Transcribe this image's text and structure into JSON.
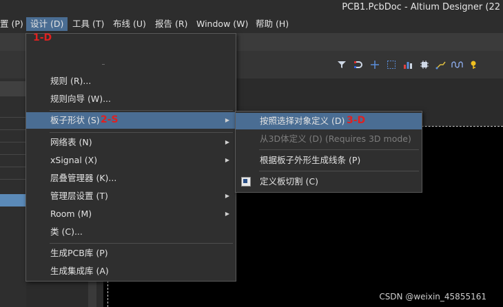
{
  "window": {
    "title": "PCB1.PcbDoc - Altium Designer (22"
  },
  "menubar": {
    "items": [
      "置 (P)",
      "设计 (D)",
      "工具 (T)",
      "布线 (U)",
      "报告 (R)",
      "Window (W)",
      "帮助 (H)"
    ]
  },
  "design_menu": {
    "items": [
      {
        "label": "规则 (R)..."
      },
      {
        "label": "规则向导 (W)..."
      },
      {
        "label": "板子形状 (S)"
      },
      {
        "label": "网络表 (N)"
      },
      {
        "label": "xSignal (X)"
      },
      {
        "label": "层叠管理器 (K)..."
      },
      {
        "label": "管理层设置 (T)"
      },
      {
        "label": "Room (M)"
      },
      {
        "label": "类 (C)..."
      },
      {
        "label": "生成PCB库 (P)"
      },
      {
        "label": "生成集成库 (A)"
      }
    ]
  },
  "board_shape_submenu": {
    "items": [
      {
        "label": "按照选择对象定义 (D)"
      },
      {
        "label": "从3D体定义 (D) (Requires 3D mode)"
      },
      {
        "label": "根据板子外形生成线条 (P)"
      },
      {
        "label": "定义板切割 (C)"
      }
    ]
  },
  "annotations": {
    "step1": "1-D",
    "step2": "2-S",
    "step3": "3-D"
  },
  "toolbar": {
    "icons": [
      "filter-icon",
      "magnet-icon",
      "crosshair-icon",
      "select-rect-icon",
      "chart-icon",
      "chip-icon",
      "route-icon",
      "wave-icon",
      "pin-icon"
    ]
  },
  "watermark": "CSDN @weixin_45855161",
  "colors": {
    "menu_highlight": "#4a6d93",
    "annotation_red": "#e02020",
    "menu_bg": "#2f2f2f"
  }
}
